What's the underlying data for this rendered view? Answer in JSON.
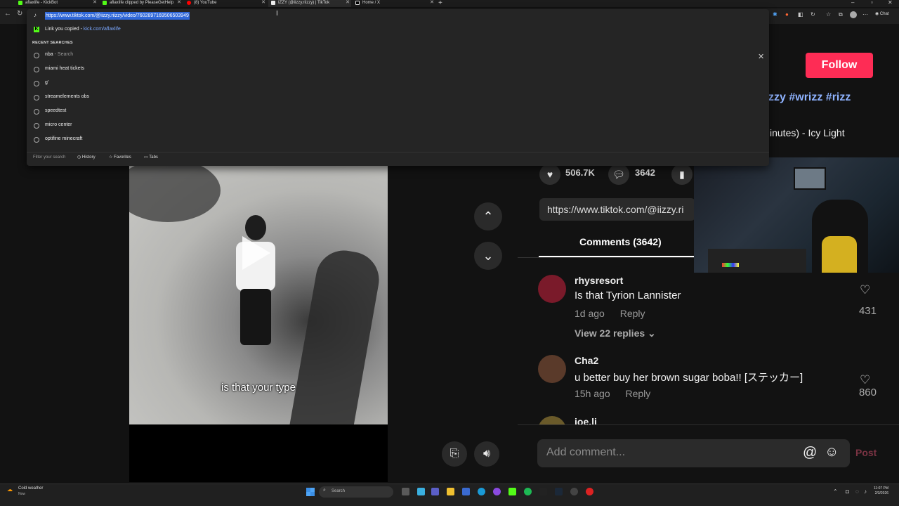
{
  "browser": {
    "tabs": [
      {
        "title": "aflaxlife - KickBot",
        "color": "#53fc18"
      },
      {
        "title": "aflaxlife clipped by PleaseGetHelp",
        "color": "#53fc18"
      },
      {
        "title": "(8) YouTube",
        "color": "#ff0000"
      },
      {
        "title": "IZZY (@iizzy.riizzy) | TikTok",
        "color": "#ffffff"
      },
      {
        "title": "Home / X",
        "color": "#ffffff"
      }
    ],
    "url": "https://www.tiktok.com/@iizzy.riizzy/video/7602897169506503949",
    "profile_button": "Chat"
  },
  "dropdown": {
    "copied_label": "Link you copied",
    "copied_sep": " - ",
    "copied_url": "kick.com/aflaxlife",
    "recent_header": "RECENT SEARCHES",
    "suggestions": [
      {
        "text": "nba",
        "sub": " - Search"
      },
      {
        "text": "miami heat tickets",
        "sub": ""
      },
      {
        "text": "g'",
        "sub": ""
      },
      {
        "text": "streamelements obs",
        "sub": ""
      },
      {
        "text": "speedtest",
        "sub": ""
      },
      {
        "text": "micro center",
        "sub": ""
      },
      {
        "text": "optifine minecraft",
        "sub": ""
      }
    ],
    "filter_placeholder": "Filter your search",
    "chips": [
      "History",
      "Favorites",
      "Tabs"
    ]
  },
  "video": {
    "caption": "is that your type"
  },
  "post": {
    "follow_label": "Follow",
    "hashtags": "zzy #wrizz #rizz",
    "music": "inutes) - Icy Light",
    "likes": "506.7K",
    "comments_count": "3642",
    "share_url": "https://www.tiktok.com/@iizzy.ri"
  },
  "comments_tab": {
    "label": "Comments (3642)"
  },
  "comments": [
    {
      "user": "rhysresort",
      "text": "Is that Tyrion Lannister",
      "time": "1d ago",
      "reply": "Reply",
      "likes": "431",
      "view_replies": "View 22 replies",
      "avatar": "#7a1a2a"
    },
    {
      "user": "Cha2",
      "text": "u better buy her brown sugar boba!! [ステッカー]",
      "time": "15h ago",
      "reply": "Reply",
      "likes": "860",
      "view_replies": "",
      "avatar": "#5a3a2a"
    },
    {
      "user": "joe.li",
      "text": "",
      "time": "",
      "reply": "",
      "likes": "",
      "view_replies": "",
      "avatar": "#6a5a2a"
    }
  ],
  "composer": {
    "placeholder": "Add comment...",
    "post_label": "Post"
  },
  "taskbar": {
    "weather": "Cold weather",
    "weather_sub": "Now",
    "search": "Search",
    "time": "11:07 PM",
    "date": "2/3/2026"
  },
  "icons": {
    "heart": "heart-icon",
    "comment": "comment-icon",
    "bookmark": "bookmark-icon",
    "volume": "volume-icon"
  }
}
